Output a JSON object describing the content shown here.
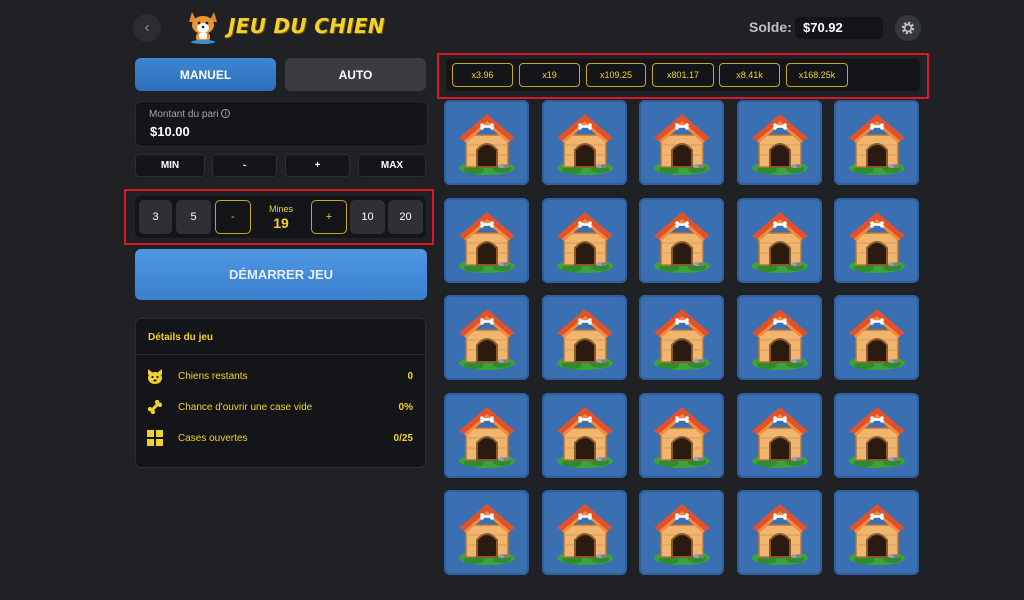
{
  "header": {
    "logo_text": "JEU DU CHIEN",
    "balance_label": "Solde:",
    "balance_value": "$70.92"
  },
  "mode_tabs": [
    "MANUEL",
    "AUTO"
  ],
  "bet": {
    "label": "Montant du pari",
    "value": "$10.00",
    "quick_buttons": [
      "MIN",
      "-",
      "+",
      "MAX"
    ]
  },
  "mines": {
    "label": "Mines",
    "value": "19",
    "presets": [
      "3",
      "5",
      "-",
      "+",
      "10",
      "20"
    ]
  },
  "start_button": "DÉMARRER JEU",
  "details": {
    "title": "Détails du jeu",
    "rows": [
      {
        "label": "Chiens restants",
        "value": "0",
        "icon": "dog-face-icon"
      },
      {
        "label": "Chance d'ouvrir une case vide",
        "value": "0%",
        "icon": "bone-icon"
      },
      {
        "label": "Cases ouvertes",
        "value": "0/25",
        "icon": "grid-icon"
      }
    ]
  },
  "multipliers": [
    "x3.96",
    "x19",
    "x109.25",
    "x801.17",
    "x8.41k",
    "x168.25k"
  ],
  "grid": {
    "rows": 5,
    "cols": 5,
    "tile": "doghouse-icon"
  },
  "colors": {
    "accent_yellow": "#f3d12b",
    "accent_blue": "#3e86d6",
    "highlight_red": "#d9182b"
  }
}
